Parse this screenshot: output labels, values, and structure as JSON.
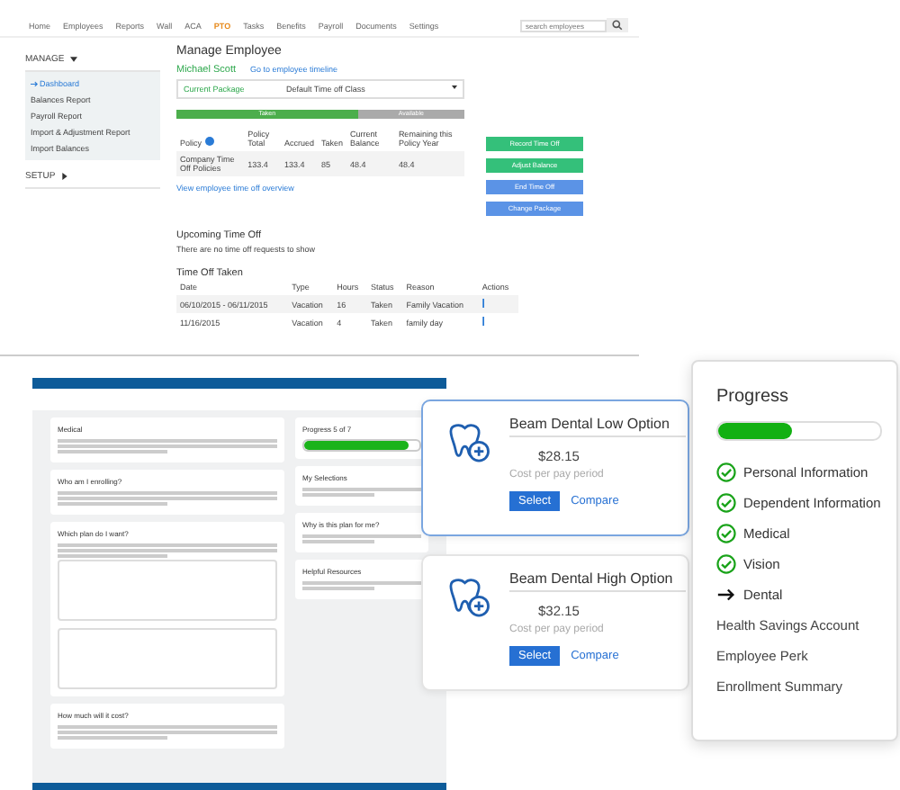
{
  "pto_app": {
    "nav": [
      {
        "label": "Home",
        "selected": false
      },
      {
        "label": "Employees",
        "selected": false
      },
      {
        "label": "Reports",
        "selected": false
      },
      {
        "label": "Wall",
        "selected": false
      },
      {
        "label": "ACA",
        "selected": false
      },
      {
        "label": "PTO",
        "selected": true
      },
      {
        "label": "Tasks",
        "selected": false
      },
      {
        "label": "Benefits",
        "selected": false
      },
      {
        "label": "Payroll",
        "selected": false
      },
      {
        "label": "Documents",
        "selected": false
      },
      {
        "label": "Settings",
        "selected": false
      }
    ],
    "search": {
      "placeholder": "search employees"
    },
    "sidebar": [
      {
        "label": "MANAGE",
        "expanded": true,
        "items": [
          {
            "label": "Dashboard",
            "selected": true
          },
          {
            "label": "Balances Report",
            "selected": false
          },
          {
            "label": "Payroll Report",
            "selected": false
          },
          {
            "label": "Import & Adjustment Report",
            "selected": false
          },
          {
            "label": "Import Balances",
            "selected": false
          }
        ]
      },
      {
        "label": "SETUP",
        "expanded": false
      }
    ],
    "title": "Manage Employee",
    "employee": "Michael Scott",
    "timeline_link": "Go to employee timeline",
    "package": {
      "label": "Current Package",
      "value": "Default Time off Class"
    },
    "balance_bar": {
      "level": 0.63,
      "taken_label": "Taken",
      "available_label": "Available"
    },
    "policy_table": {
      "columns": [
        "Policy",
        "Policy Total",
        "Accrued",
        "Taken",
        "Current Balance",
        "Remaining this Policy Year"
      ],
      "rows": [
        [
          "Company Time Off Policies",
          "133.4",
          "133.4",
          "85",
          "48.4",
          "48.4"
        ]
      ]
    },
    "overview_link": "View employee time off overview",
    "buttons": [
      {
        "label": "Record Time Off",
        "kind": "green"
      },
      {
        "label": "Adjust Balance",
        "kind": "green"
      },
      {
        "label": "End Time Off",
        "kind": "blue"
      },
      {
        "label": "Change Package",
        "kind": "blue"
      }
    ],
    "upcoming": {
      "heading": "Upcoming Time Off",
      "empty": "There are no time off requests to show"
    },
    "taken": {
      "heading": "Time Off Taken",
      "columns": [
        "Date",
        "Type",
        "Hours",
        "Status",
        "Reason",
        "Actions"
      ],
      "rows": [
        [
          "06/10/2015 - 06/11/2015",
          "Vacation",
          "16",
          "Taken",
          "Family Vacation"
        ],
        [
          "11/16/2015",
          "Vacation",
          "4",
          "Taken",
          "family day"
        ]
      ]
    }
  },
  "benefits_app": {
    "sections": [
      "Medical",
      "Who am I enrolling?",
      "Which plan do I want?",
      "How much will it cost?"
    ],
    "progress": {
      "title": "Progress 5 of 7",
      "level": 0.9
    },
    "side_sections": [
      "My Selections",
      "Why is this plan for me?",
      "Helpful Resources"
    ]
  },
  "dental_options": [
    {
      "name": "Beam Dental Low Option",
      "price": "$28.15",
      "caption": "Cost per pay period",
      "select": "Select",
      "compare": "Compare",
      "selected": true
    },
    {
      "name": "Beam Dental High Option",
      "price": "$32.15",
      "caption": "Cost per pay period",
      "select": "Select",
      "compare": "Compare",
      "selected": false
    }
  ],
  "progress_panel": {
    "title": "Progress",
    "level": 0.45,
    "steps": [
      {
        "label": "Personal Information",
        "kind": "done"
      },
      {
        "label": "Dependent Information",
        "kind": "done"
      },
      {
        "label": "Medical",
        "kind": "done"
      },
      {
        "label": "Vision",
        "kind": "done"
      },
      {
        "label": "Dental",
        "kind": "current"
      },
      {
        "label": "Health Savings Account",
        "kind": "todo"
      },
      {
        "label": "Employee Perk",
        "kind": "todo"
      },
      {
        "label": "Enrollment Summary",
        "kind": "todo"
      }
    ]
  }
}
